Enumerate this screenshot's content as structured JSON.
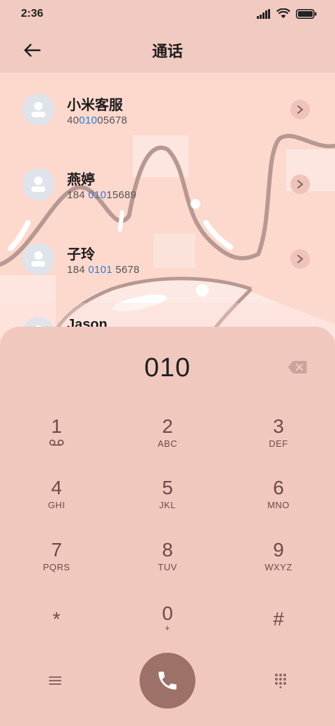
{
  "status": {
    "time": "2:36"
  },
  "header": {
    "title": "通话"
  },
  "contacts": [
    {
      "name": "小米客服",
      "number_pre": "40",
      "number_hl": "010",
      "number_post": "05678"
    },
    {
      "name": "燕婷",
      "number_pre": "184 ",
      "number_hl": "010",
      "number_post": "15689"
    },
    {
      "name": "子玲",
      "number_pre": "184 ",
      "number_hl": "0101",
      "number_post": " 5678"
    },
    {
      "name": "Jason"
    }
  ],
  "dialpad": {
    "input": "010",
    "keys": [
      {
        "digit": "1",
        "sub": ""
      },
      {
        "digit": "2",
        "sub": "ABC"
      },
      {
        "digit": "3",
        "sub": "DEF"
      },
      {
        "digit": "4",
        "sub": "GHI"
      },
      {
        "digit": "5",
        "sub": "JKL"
      },
      {
        "digit": "6",
        "sub": "MNO"
      },
      {
        "digit": "7",
        "sub": "PQRS"
      },
      {
        "digit": "8",
        "sub": "TUV"
      },
      {
        "digit": "9",
        "sub": "WXYZ"
      },
      {
        "digit": "*",
        "sub": ""
      },
      {
        "digit": "0",
        "sub": "+"
      },
      {
        "digit": "#",
        "sub": ""
      }
    ]
  },
  "icons": {
    "back": "arrow-left-icon",
    "chevron": "chevron-right-icon",
    "backspace": "backspace-icon",
    "voicemail": "voicemail-icon",
    "menu": "menu-icon",
    "call": "phone-icon",
    "keypad": "keypad-icon"
  },
  "colors": {
    "background": "#fcd8cd",
    "dialpad": "#f0c8be",
    "highlight": "#2e7be0",
    "call_button": "#9e7168"
  }
}
